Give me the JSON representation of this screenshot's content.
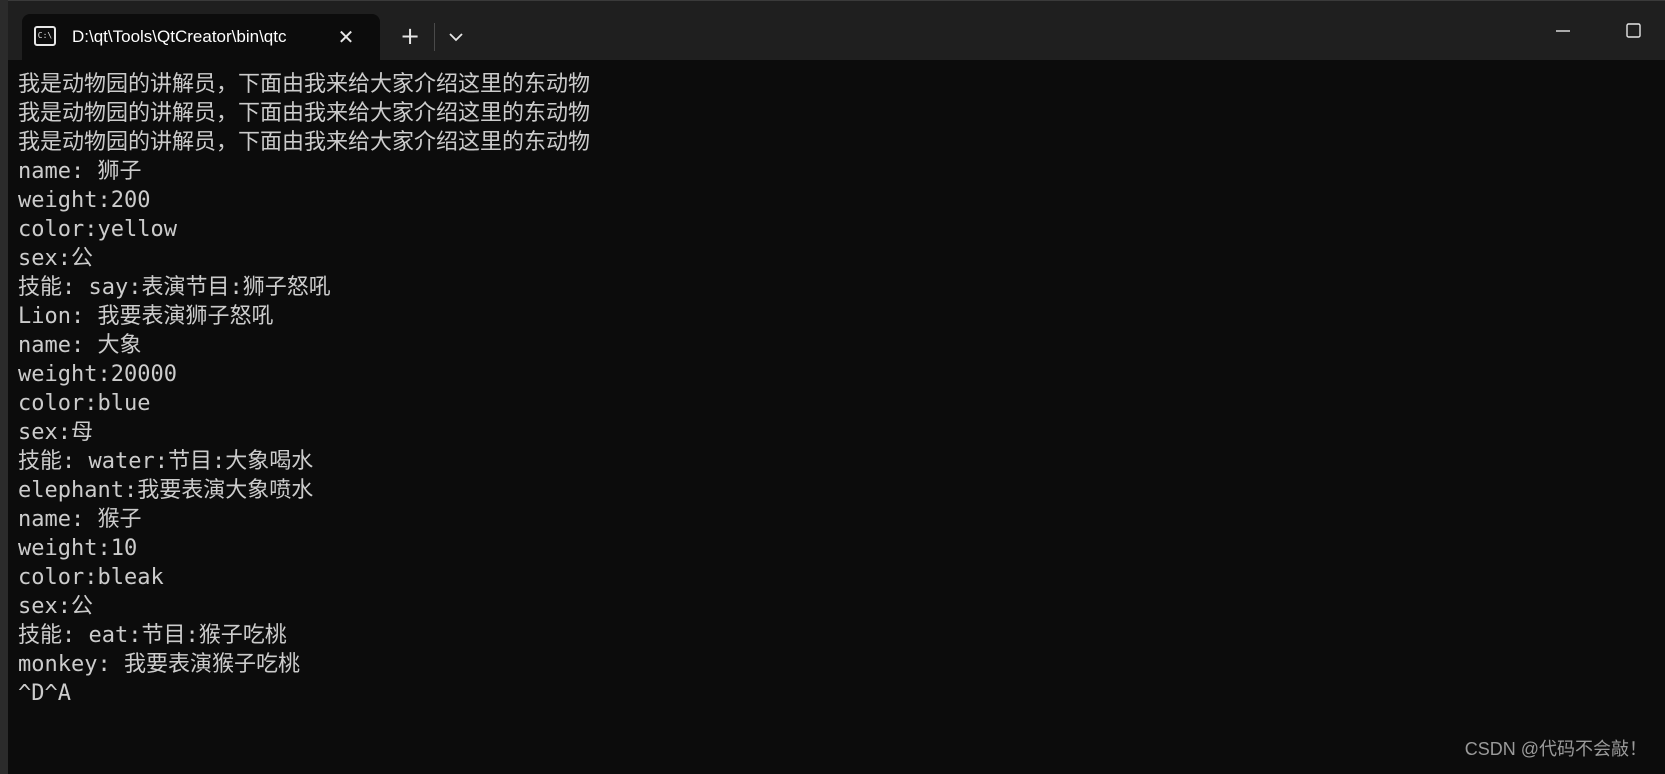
{
  "window": {
    "tab_title": "D:\\qt\\Tools\\QtCreator\\bin\\qtc",
    "tab_icon_text": "C:\\",
    "tab_icon": "console-icon",
    "new_tab_symbol": "+",
    "close_symbol": "✕"
  },
  "console": {
    "lines": [
      "我是动物园的讲解员，下面由我来给大家介绍这里的东动物",
      "我是动物园的讲解员，下面由我来给大家介绍这里的东动物",
      "我是动物园的讲解员，下面由我来给大家介绍这里的东动物",
      "name: 狮子",
      "weight:200",
      "color:yellow",
      "sex:公",
      "技能: say:表演节目:狮子怒吼",
      "Lion: 我要表演狮子怒吼",
      "name: 大象",
      "weight:20000",
      "color:blue",
      "sex:母",
      "技能: water:节目:大象喝水",
      "elephant:我要表演大象喷水",
      "name: 猴子",
      "weight:10",
      "color:bleak",
      "sex:公",
      "技能: eat:节目:猴子吃桃",
      "monkey: 我要表演猴子吃桃",
      "^D^A"
    ]
  },
  "watermark": "CSDN @代码不会敲！",
  "colors": {
    "background": "#0c0c0c",
    "titlebar": "#1f1f1f",
    "text": "#cccccc"
  }
}
